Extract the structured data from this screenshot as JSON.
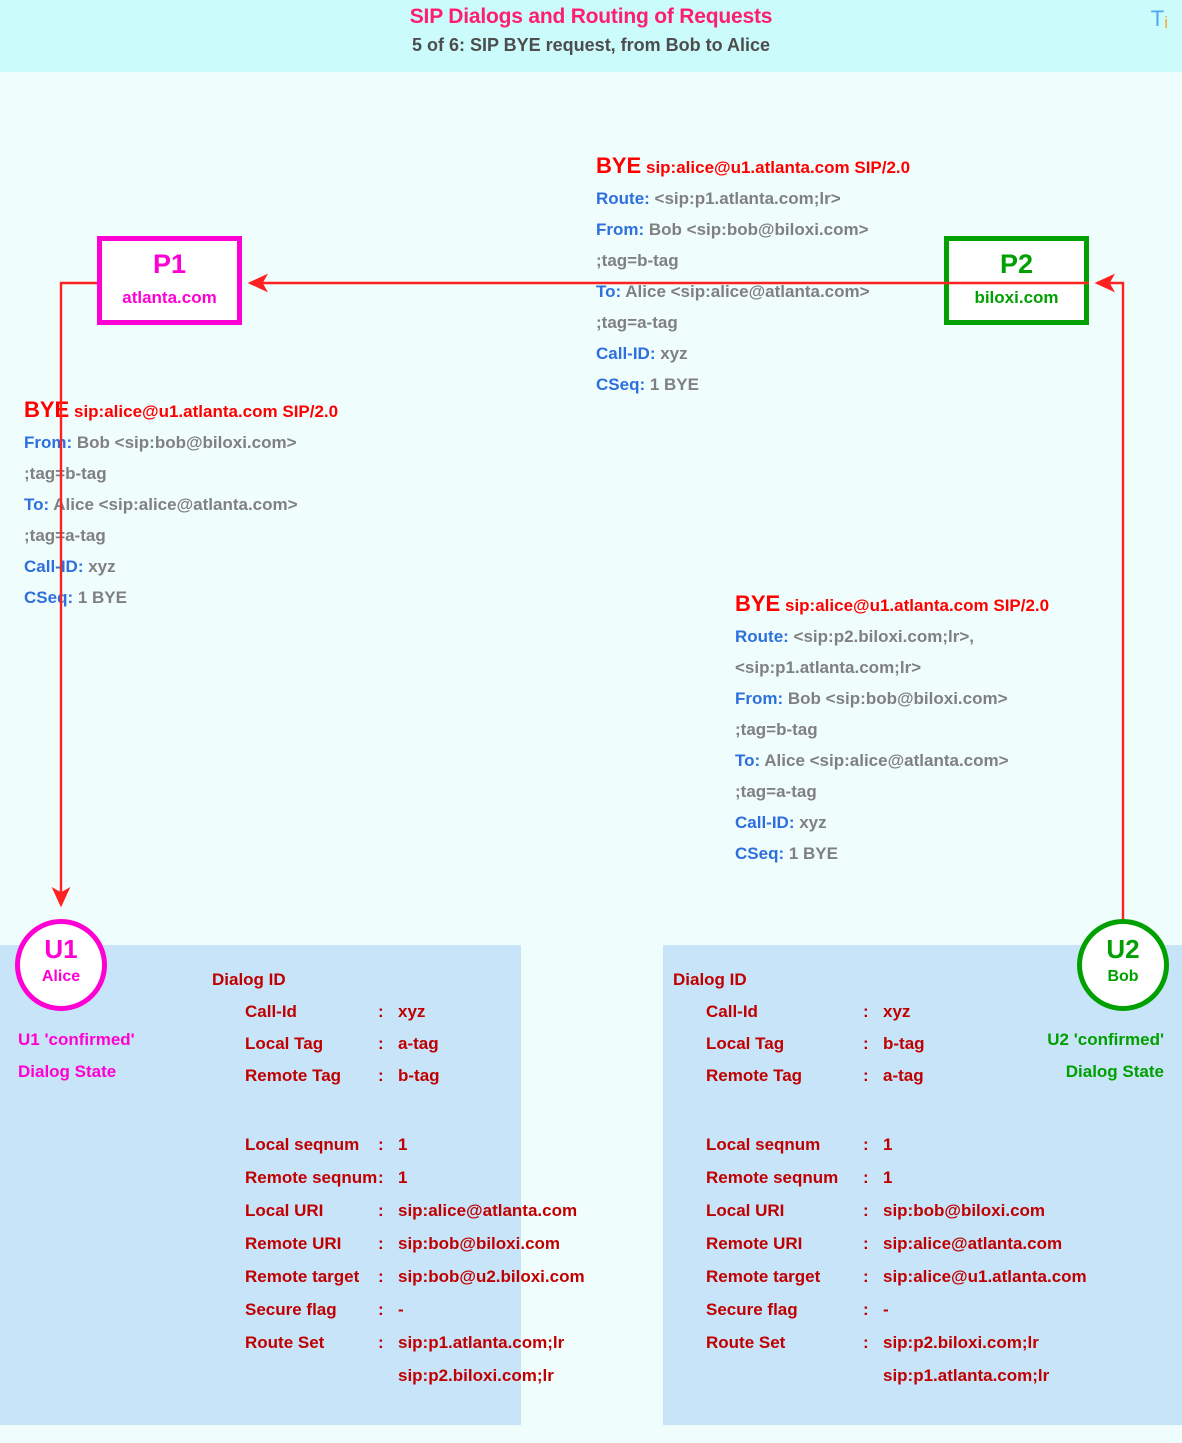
{
  "header": {
    "title": "SIP Dialogs and Routing of Requests",
    "subtitle": "5 of 6: SIP BYE request, from Bob to Alice",
    "logo_t": "T",
    "logo_i": "i"
  },
  "colors": {
    "page_bg": "#f0fdfd",
    "header_bg": "#ccfbfc",
    "title_pink": "#ff1e6e",
    "subtitle_gray": "#4d4d4d",
    "magenta": "#ff00d4",
    "green": "#00a000",
    "arrow_red": "#ff2020",
    "sip_red": "#ff0000",
    "header_blue": "#2d6fdd",
    "value_gray": "#808080",
    "panel_blue": "#c8e4f8",
    "panel_text_red": "#c00000"
  },
  "nodes": {
    "p1": {
      "name": "P1",
      "domain": "atlanta.com"
    },
    "p2": {
      "name": "P2",
      "domain": "biloxi.com"
    },
    "u1": {
      "name": "U1",
      "user": "Alice"
    },
    "u2": {
      "name": "U2",
      "user": "Bob"
    }
  },
  "state_captions": {
    "u1_line1": "U1 'confirmed'",
    "u1_line2": "Dialog State",
    "u2_line1": "U2 'confirmed'",
    "u2_line2": "Dialog State"
  },
  "messages": {
    "top_right": {
      "method": "BYE",
      "request_uri": "sip:alice@u1.atlanta.com SIP/2.0",
      "lines": [
        {
          "header": "Route",
          "value": "<sip:p1.atlanta.com;lr>"
        },
        {
          "header": "From",
          "value": "Bob <sip:bob@biloxi.com>"
        },
        {
          "continuation": " ;tag=b-tag"
        },
        {
          "header": "To",
          "value": "Alice <sip:alice@atlanta.com>"
        },
        {
          "continuation": " ;tag=a-tag"
        },
        {
          "header": "Call-ID",
          "value": "xyz"
        },
        {
          "header": "CSeq",
          "value": "1 BYE"
        }
      ]
    },
    "left": {
      "method": "BYE",
      "request_uri": "sip:alice@u1.atlanta.com SIP/2.0",
      "lines": [
        {
          "header": "From",
          "value": "Bob <sip:bob@biloxi.com>"
        },
        {
          "continuation": " ;tag=b-tag"
        },
        {
          "header": "To",
          "value": "Alice <sip:alice@atlanta.com>"
        },
        {
          "continuation": " ;tag=a-tag"
        },
        {
          "header": "Call-ID",
          "value": "xyz"
        },
        {
          "header": "CSeq",
          "value": "1 BYE"
        }
      ]
    },
    "bottom_right": {
      "method": "BYE",
      "request_uri": "sip:alice@u1.atlanta.com SIP/2.0",
      "lines": [
        {
          "header": "Route",
          "value": "<sip:p2.biloxi.com;lr>,"
        },
        {
          "continuation": " <sip:p1.atlanta.com;lr>"
        },
        {
          "header": "From",
          "value": "Bob <sip:bob@biloxi.com>"
        },
        {
          "continuation": " ;tag=b-tag"
        },
        {
          "header": "To",
          "value": "Alice <sip:alice@atlanta.com>"
        },
        {
          "continuation": " ;tag=a-tag"
        },
        {
          "header": "Call-ID",
          "value": "xyz"
        },
        {
          "header": "CSeq",
          "value": "1 BYE"
        }
      ]
    }
  },
  "dialog_panels": {
    "u1": {
      "dialog_id_title": "Dialog ID",
      "dialog_id_rows": [
        {
          "key": "Call-Id",
          "colon": ":",
          "value": "xyz"
        },
        {
          "key": "Local Tag",
          "colon": ":",
          "value": "a-tag"
        },
        {
          "key": "Remote Tag",
          "colon": ":",
          "value": "b-tag"
        }
      ],
      "rows": [
        {
          "key": "Local seqnum",
          "colon": ":",
          "value": "1"
        },
        {
          "key": "Remote seqnum",
          "colon": ":",
          "value": "1"
        },
        {
          "key": "Local URI",
          "colon": ":",
          "value": "sip:alice@atlanta.com"
        },
        {
          "key": "Remote URI",
          "colon": ":",
          "value": "sip:bob@biloxi.com"
        },
        {
          "key": "Remote target",
          "colon": ":",
          "value": "sip:bob@u2.biloxi.com"
        },
        {
          "key": "Secure flag",
          "colon": ":",
          "value": "-"
        },
        {
          "key": "Route Set",
          "colon": ":",
          "value": "sip:p1.atlanta.com;lr"
        }
      ],
      "route_set_extra": "sip:p2.biloxi.com;lr"
    },
    "u2": {
      "dialog_id_title": "Dialog ID",
      "dialog_id_rows": [
        {
          "key": "Call-Id",
          "colon": ":",
          "value": "xyz"
        },
        {
          "key": "Local Tag",
          "colon": ":",
          "value": "b-tag"
        },
        {
          "key": "Remote Tag",
          "colon": ":",
          "value": "a-tag"
        }
      ],
      "rows": [
        {
          "key": "Local seqnum",
          "colon": ":",
          "value": "1"
        },
        {
          "key": "Remote seqnum",
          "colon": ":",
          "value": "1"
        },
        {
          "key": "Local URI",
          "colon": ":",
          "value": "sip:bob@biloxi.com"
        },
        {
          "key": "Remote URI",
          "colon": ":",
          "value": "sip:alice@atlanta.com"
        },
        {
          "key": "Remote target",
          "colon": ":",
          "value": "sip:alice@u1.atlanta.com"
        },
        {
          "key": "Secure flag",
          "colon": ":",
          "value": "-"
        },
        {
          "key": "Route Set",
          "colon": ":",
          "value": "sip:p2.biloxi.com;lr"
        }
      ],
      "route_set_extra": "sip:p1.atlanta.com;lr"
    }
  }
}
